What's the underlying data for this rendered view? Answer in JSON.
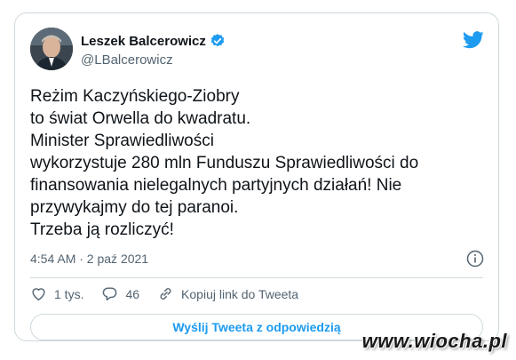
{
  "author": {
    "name": "Leszek Balcerowicz",
    "handle": "@LBalcerowicz"
  },
  "tweet": {
    "text": "Reżim Kaczyńskiego-Ziobry\nto świat Orwella do kwadratu.\nMinister Sprawiedliwości\nwykorzystuje 280 mln Funduszu Sprawiedliwości do\nfinansowania nielegalnych partyjnych działań! Nie\nprzywykajmy do tej paranoi.\nTrzeba ją rozliczyć!",
    "timestamp": "4:54 AM · 2 paź 2021"
  },
  "actions": {
    "likes": "1 tys.",
    "replies": "46",
    "copy_link": "Kopiuj link do Tweeta"
  },
  "reply_button": "Wyślij Tweeta z odpowiedzią",
  "watermark": "www.wiocha.pl",
  "colors": {
    "accent": "#1d9bf0",
    "border": "#cfd9de",
    "muted": "#536471"
  },
  "icons": [
    "verified-icon",
    "twitter-bird-icon",
    "info-icon",
    "heart-icon",
    "reply-icon",
    "link-icon"
  ]
}
